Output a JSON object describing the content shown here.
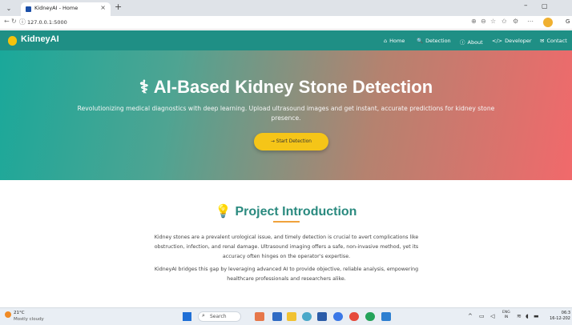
{
  "browser": {
    "tab_title": "KidneyAI - Home",
    "tab_close": "×",
    "new_tab": "+",
    "url": "127.0.0.1:5000",
    "profile_label": "G",
    "minimize": "–",
    "maximize": "▢"
  },
  "site": {
    "brand": "KidneyAI",
    "nav": [
      {
        "icon": "⌂",
        "label": "Home"
      },
      {
        "icon": "🔍",
        "label": "Detection"
      },
      {
        "icon": "ⓘ",
        "label": "About"
      },
      {
        "icon": "</>",
        "label": "Developer"
      },
      {
        "icon": "✉",
        "label": "Contact"
      }
    ]
  },
  "hero": {
    "icon": "⚕",
    "title": "AI-Based Kidney Stone Detection",
    "subtitle": "Revolutionizing medical diagnostics with deep learning. Upload ultrasound images and get instant, accurate predictions for kidney stone presence.",
    "button": "→ Start Detection"
  },
  "intro": {
    "icon": "💡",
    "title": "Project Introduction",
    "paragraph1": "Kidney stones are a prevalent urological issue, and timely detection is crucial to avert complications like obstruction, infection, and renal damage. Ultrasound imaging offers a safe, non-invasive method, yet its accuracy often hinges on the operator's expertise.",
    "paragraph2": "KidneyAI bridges this gap by leveraging advanced AI to provide objective, reliable analysis, empowering healthcare professionals and researchers alike."
  },
  "taskbar": {
    "weather_temp": "21°C",
    "weather_desc": "Mostly cloudy",
    "search_placeholder": "Search",
    "lang_top": "ENG",
    "lang_bottom": "IN",
    "time": "06:3",
    "date": "16-12-202"
  }
}
